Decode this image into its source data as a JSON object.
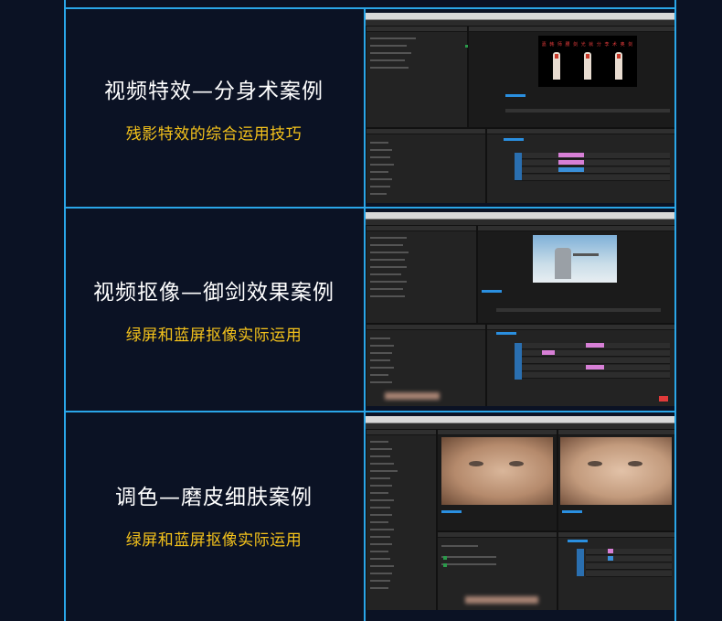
{
  "rows": [
    {
      "title": "视频特效—分身术案例",
      "subtitle": "残影特效的综合运用技巧",
      "screenshot": "premiere-clone-effect",
      "preview_caption": "嘉 韩 师 腰 剑 光 就 分 李 术 奥 剑"
    },
    {
      "title": "视频抠像—御剑效果案例",
      "subtitle": "绿屏和蓝屏抠像实际运用",
      "screenshot": "premiere-keying"
    },
    {
      "title": "调色—磨皮细肤案例",
      "subtitle": "绿屏和蓝屏抠像实际运用",
      "screenshot": "premiere-skin-smoothing"
    }
  ],
  "colors": {
    "background": "#0b1224",
    "border": "#2aa6e8",
    "title": "#ffffff",
    "subtitle": "#f4c21b",
    "clip_pink": "#d77fd6",
    "clip_blue": "#3a8fd8"
  }
}
